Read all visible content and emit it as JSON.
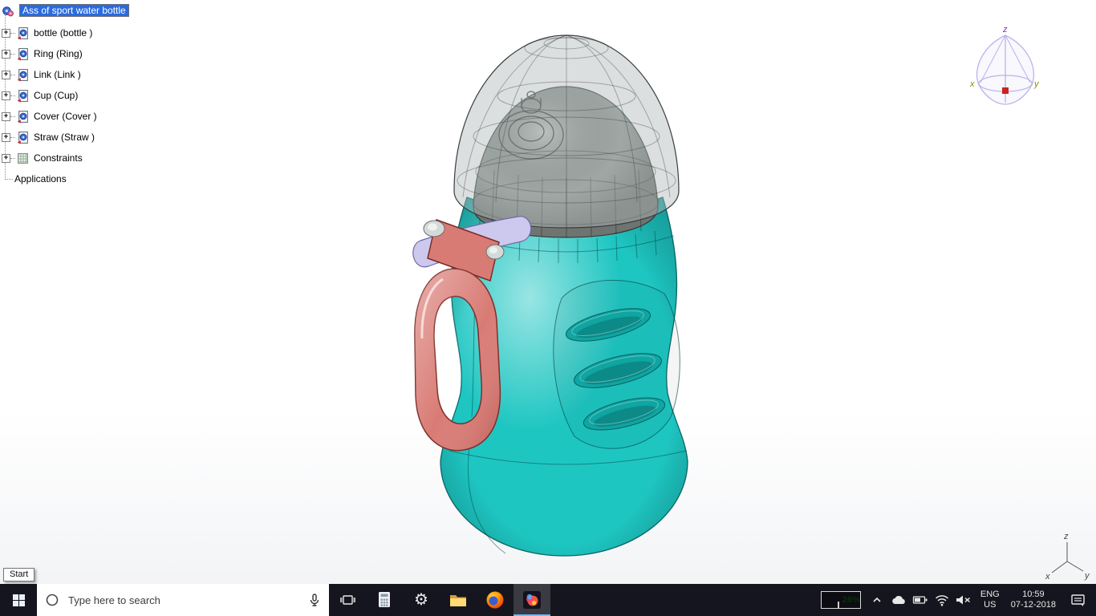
{
  "tree": {
    "root_label": "Ass of sport water bottle",
    "expander_glyph": "+",
    "items": [
      {
        "label": "bottle  (bottle )"
      },
      {
        "label": "Ring (Ring)"
      },
      {
        "label": "Link  (Link )"
      },
      {
        "label": "Cup (Cup)"
      },
      {
        "label": "Cover  (Cover )"
      },
      {
        "label": "Straw  (Straw )"
      },
      {
        "label": "Constraints"
      },
      {
        "label": "Applications"
      }
    ]
  },
  "tooltip": {
    "label": "Start"
  },
  "taskbar": {
    "search": {
      "placeholder": "Type here to search"
    },
    "battery": "26%",
    "language": {
      "line1": "ENG",
      "line2": "US"
    },
    "clock": {
      "time": "10:59",
      "date": "07-12-2018"
    }
  },
  "viewport": {
    "compass": {
      "x": "x",
      "y": "y",
      "z": "z"
    },
    "triad": {
      "x": "x",
      "y": "y",
      "z": "z"
    }
  },
  "colors": {
    "body_teal": "#1ec6c2",
    "cap_gray": "#939b96",
    "dome_glass": "rgba(176,183,185,0.45)",
    "handle_red": "#d97b75",
    "ring_lavender": "#cdc9ee",
    "slot_teal": "#0fa5a2"
  }
}
